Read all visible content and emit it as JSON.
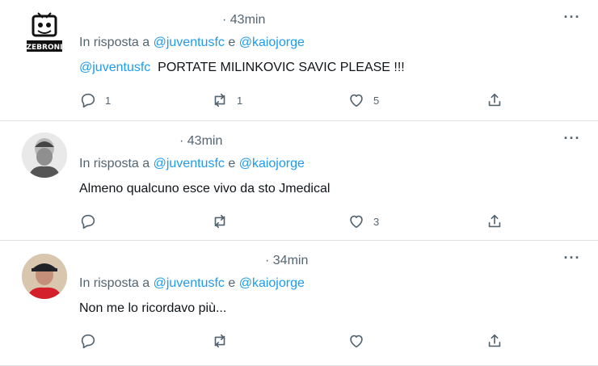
{
  "tweets": [
    {
      "time": "· 43min",
      "reply_prefix": "In risposta a",
      "reply_user1": "@juventusfc",
      "reply_and": "e",
      "reply_user2": "@kaiojorge",
      "text_mention": "@juventusfc",
      "text": "PORTATE MILINKOVIC SAVIC PLEASE !!!",
      "replies": "1",
      "retweets": "1",
      "likes": "5",
      "avatar_label": "ZEBRONI"
    },
    {
      "time": "· 43min",
      "reply_prefix": "In risposta a",
      "reply_user1": "@juventusfc",
      "reply_and": "e",
      "reply_user2": "@kaiojorge",
      "text": "Almeno qualcuno esce vivo da sto Jmedical",
      "likes": "3"
    },
    {
      "time": "· 34min",
      "reply_prefix": "In risposta a",
      "reply_user1": "@juventusfc",
      "reply_and": "e",
      "reply_user2": "@kaiojorge",
      "text": "Non me lo ricordavo più..."
    }
  ],
  "icons": {
    "more": "more-options-icon",
    "reply": "reply-icon",
    "retweet": "retweet-icon",
    "like": "heart-icon",
    "share": "share-icon"
  },
  "colors": {
    "accent": "#1d9bf0",
    "secondary_text": "#536471",
    "divider": "#dfe3e6"
  }
}
